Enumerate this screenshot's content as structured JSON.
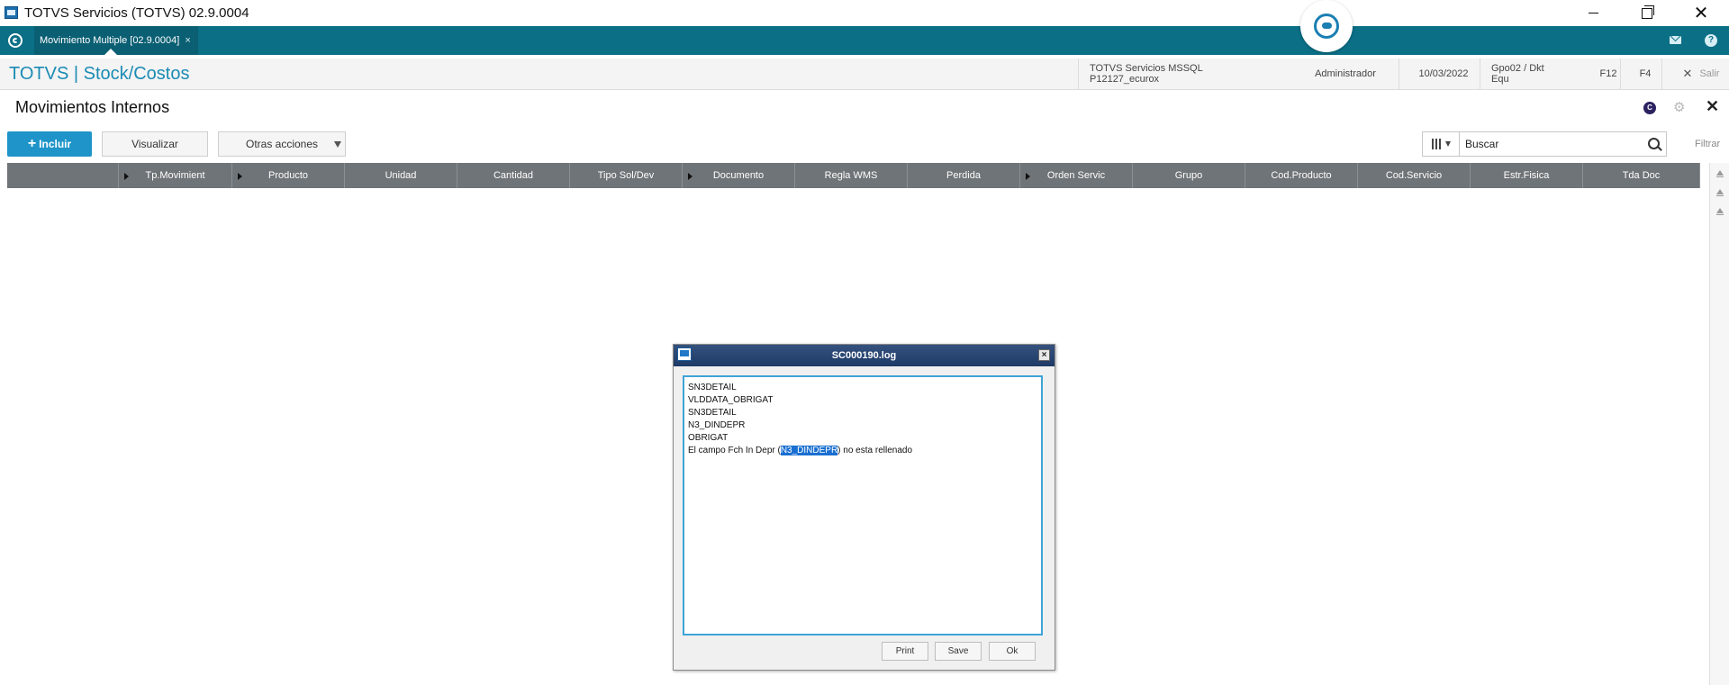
{
  "window": {
    "title": "TOTVS Servicios (TOTVS) 02.9.0004"
  },
  "tabs": [
    {
      "label": "Movimiento Multiple [02.9.0004]",
      "close": "×"
    }
  ],
  "module": {
    "title": "TOTVS | Stock/Costos",
    "environment": "TOTVS Servicios MSSQL P12127_ecurox",
    "user": "Administrador",
    "date": "10/03/2022",
    "branch": "Gpo02 / Dkt Equ",
    "shortcut_f12": "F12",
    "shortcut_f4": "F4",
    "exit_label": "Salir"
  },
  "page": {
    "title": "Movimientos Internos"
  },
  "toolbar": {
    "include_label": "Incluir",
    "view_label": "Visualizar",
    "other_actions_label": "Otras acciones",
    "search_value": "Buscar",
    "filter_label": "Filtrar"
  },
  "grid": {
    "columns": [
      "",
      "Tp.Movimient",
      "Producto",
      "Unidad",
      "Cantidad",
      "Tipo Sol/Dev",
      "Documento",
      "Regla WMS",
      "Perdida",
      "Orden Servic",
      "Grupo",
      "Cod.Producto",
      "Cod.Servicio",
      "Estr.Fisica",
      "Tda Doc"
    ]
  },
  "dialog": {
    "title": "SC000190.log",
    "log_lines": [
      "SN3DETAIL",
      "VLDDATA_OBRIGAT",
      "SN3DETAIL",
      "N3_DINDEPR",
      "OBRIGAT"
    ],
    "message_before": "El campo Fch In Depr (",
    "message_highlight": "N3_DINDEPR",
    "message_after": ") no esta rellenado",
    "print_label": "Print",
    "save_label": "Save",
    "ok_label": "Ok"
  },
  "colors": {
    "tabbar": "#0b6f86",
    "module_title": "#1b8bb4",
    "primary_button": "#1e94c9",
    "grid_header": "#6f7478",
    "dialog_title": "#1e3a66"
  }
}
